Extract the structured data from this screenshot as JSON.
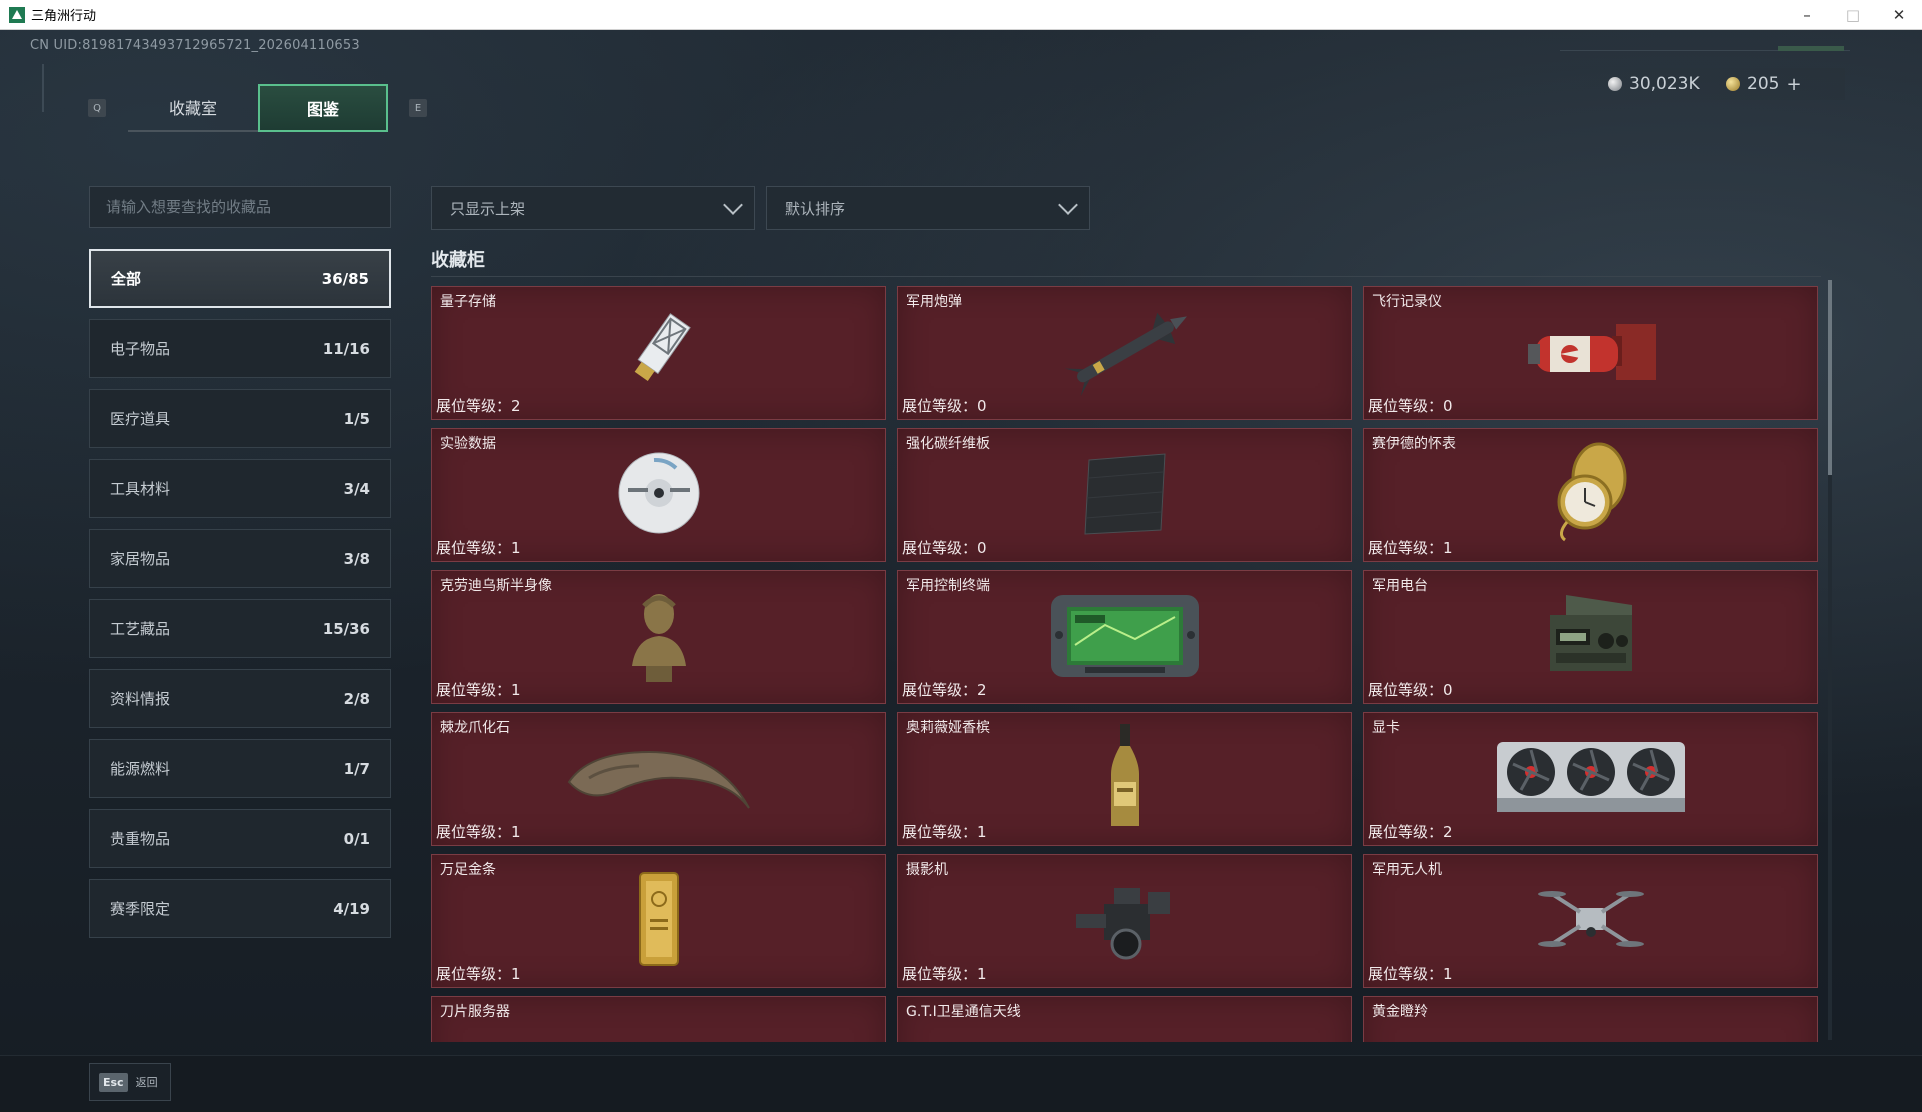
{
  "window": {
    "title": "三角洲行动",
    "minimize": "–",
    "maximize": "□",
    "close": "✕"
  },
  "uid": "CN UID:819817434937129657​21_202604110653",
  "currency": {
    "silver": "30,023K",
    "gold": "205",
    "gold_add": "+"
  },
  "tabs": {
    "prev_key": "Q",
    "next_key": "E",
    "collection": "收藏室",
    "catalog": "图鉴",
    "active": "catalog"
  },
  "search": {
    "placeholder": "请输入想要查找的收藏品"
  },
  "categories": [
    {
      "label": "全部",
      "count": "36/85",
      "active": true
    },
    {
      "label": "电子物品",
      "count": "11/16"
    },
    {
      "label": "医疗道具",
      "count": "1/5"
    },
    {
      "label": "工具材料",
      "count": "3/4"
    },
    {
      "label": "家居物品",
      "count": "3/8"
    },
    {
      "label": "工艺藏品",
      "count": "15/36"
    },
    {
      "label": "资料情报",
      "count": "2/8"
    },
    {
      "label": "能源燃料",
      "count": "1/7"
    },
    {
      "label": "贵重物品",
      "count": "0/1"
    },
    {
      "label": "赛季限定",
      "count": "4/19"
    }
  ],
  "filters": {
    "show_filter": "只显示上架",
    "sort": "默认排序"
  },
  "section_title": "收藏柜",
  "level_prefix": "展位等级：",
  "items": [
    {
      "name": "量子存储",
      "level": "2",
      "icon": "usb-drive-icon"
    },
    {
      "name": "军用炮弹",
      "level": "0",
      "icon": "missile-icon"
    },
    {
      "name": "飞行记录仪",
      "level": "0",
      "icon": "flight-recorder-icon"
    },
    {
      "name": "实验数据",
      "level": "1",
      "icon": "disc-icon"
    },
    {
      "name": "强化碳纤维板",
      "level": "0",
      "icon": "carbon-plate-icon"
    },
    {
      "name": "赛伊德的怀表",
      "level": "1",
      "icon": "pocket-watch-icon"
    },
    {
      "name": "克劳迪乌斯半身像",
      "level": "1",
      "icon": "bust-icon"
    },
    {
      "name": "军用控制终端",
      "level": "2",
      "icon": "terminal-icon"
    },
    {
      "name": "军用电台",
      "level": "0",
      "icon": "radio-icon"
    },
    {
      "name": "棘龙爪化石",
      "level": "1",
      "icon": "claw-fossil-icon"
    },
    {
      "name": "奥莉薇娅香槟",
      "level": "1",
      "icon": "champagne-icon"
    },
    {
      "name": "显卡",
      "level": "2",
      "icon": "graphics-card-icon"
    },
    {
      "name": "万足金条",
      "level": "1",
      "icon": "gold-bar-icon"
    },
    {
      "name": "摄影机",
      "level": "1",
      "icon": "camera-icon"
    },
    {
      "name": "军用无人机",
      "level": "1",
      "icon": "drone-icon"
    },
    {
      "name": "刀片服务器",
      "level": "",
      "icon": "server-icon"
    },
    {
      "name": "G.T.I卫星通信天线",
      "level": "",
      "icon": "antenna-icon"
    },
    {
      "name": "黄金瞪羚",
      "level": "",
      "icon": "gazelle-icon"
    }
  ],
  "footer": {
    "esc_key": "Esc",
    "back_label": "返回"
  }
}
